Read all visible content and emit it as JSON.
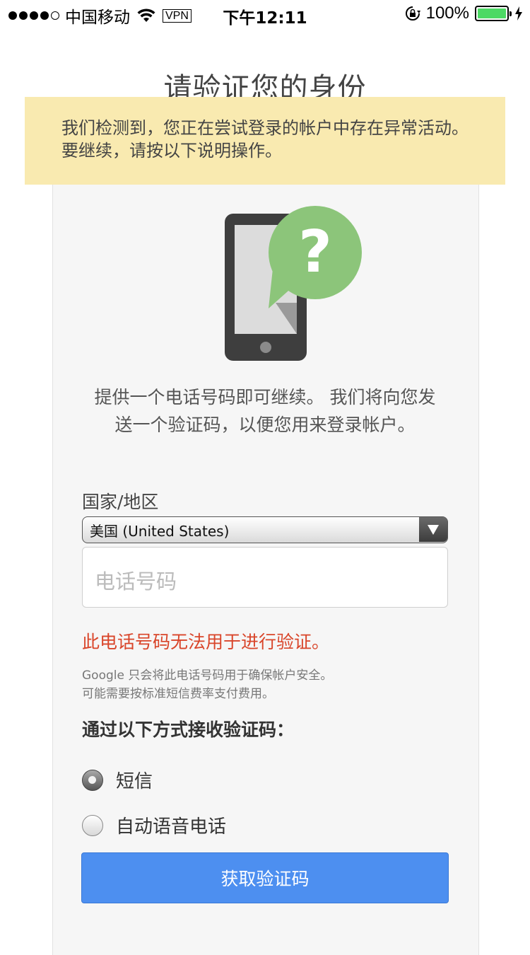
{
  "status_bar": {
    "carrier": "中国移动",
    "vpn": "VPN",
    "time": "下午12:11",
    "battery": "100%",
    "battery_color": "#4cd964"
  },
  "page": {
    "title": "请验证您的身份",
    "warning": "我们检测到，您正在尝试登录的帐户中存在异常活动。要继续，请按以下说明操作。",
    "description": "提供一个电话号码即可继续。 我们将向您发送一个验证码，以便您用来登录帐户。",
    "illustration_icon": "phone-question-icon"
  },
  "form": {
    "country_label": "国家/地区",
    "country_value": "美国 (United States)",
    "phone_placeholder": "电话号码",
    "error": "此电话号码无法用于进行验证。",
    "note_line1": "Google 只会将此电话号码用于确保帐户安全。",
    "note_line2": "可能需要按标准短信费率支付费用。",
    "method_label": "通过以下方式接收验证码：",
    "methods": [
      {
        "label": "短信",
        "checked": true
      },
      {
        "label": "自动语音电话",
        "checked": false
      }
    ],
    "submit": "获取验证码"
  },
  "colors": {
    "accent": "#4d8ff0",
    "warning_bg": "#f9eab0",
    "error": "#d9452a",
    "bubble": "#8cc57a"
  }
}
